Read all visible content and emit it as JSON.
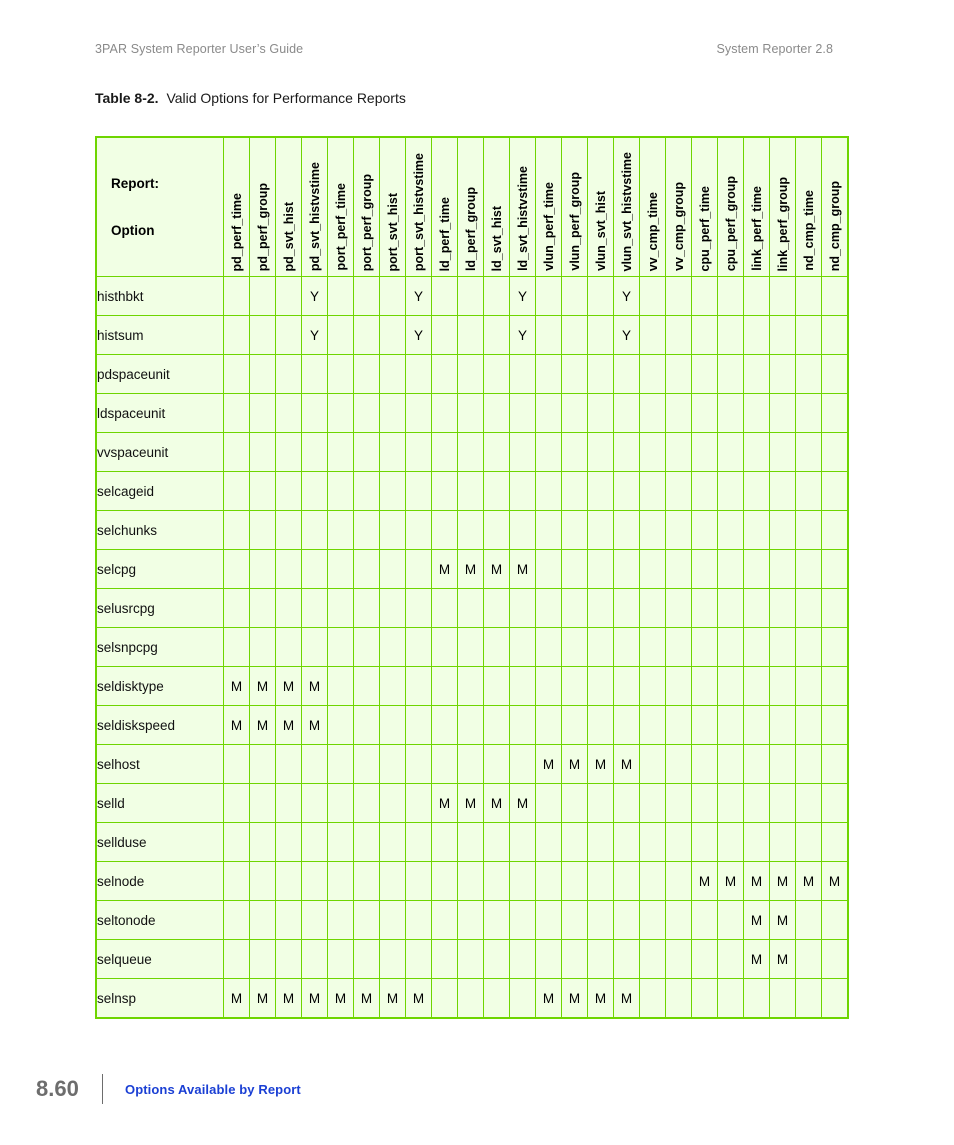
{
  "running_head": {
    "left": "3PAR System Reporter User’s Guide",
    "right": "System Reporter 2.8"
  },
  "caption": {
    "label": "Table 8-2.",
    "text": "Valid Options for Performance Reports"
  },
  "table": {
    "corner": {
      "report_label": "Report:",
      "option_label": "Option"
    },
    "columns": [
      "pd_perf_time",
      "pd_perf_group",
      "pd_svt_hist",
      "pd_svt_histvstime",
      "port_perf_time",
      "port_perf_group",
      "port_svt_hist",
      "port_svt_histvstime",
      "ld_perf_time",
      "ld_perf_group",
      "ld_svt_hist",
      "ld_svt_histvstime",
      "vlun_perf_time",
      "vlun_perf_group",
      "vlun_svt_hist",
      "vlun_svt_histvstime",
      "vv_cmp_time",
      "vv_cmp_group",
      "cpu_perf_time",
      "cpu_perf_group",
      "link_perf_time",
      "link_perf_group",
      "nd_cmp_time",
      "nd_cmp_group"
    ],
    "rows": [
      {
        "label": "histhbkt",
        "cells": [
          "",
          "",
          "",
          "Y",
          "",
          "",
          "",
          "Y",
          "",
          "",
          "",
          "Y",
          "",
          "",
          "",
          "Y",
          "",
          "",
          "",
          "",
          "",
          "",
          "",
          ""
        ]
      },
      {
        "label": "histsum",
        "cells": [
          "",
          "",
          "",
          "Y",
          "",
          "",
          "",
          "Y",
          "",
          "",
          "",
          "Y",
          "",
          "",
          "",
          "Y",
          "",
          "",
          "",
          "",
          "",
          "",
          "",
          ""
        ]
      },
      {
        "label": "pdspaceunit",
        "cells": [
          "",
          "",
          "",
          "",
          "",
          "",
          "",
          "",
          "",
          "",
          "",
          "",
          "",
          "",
          "",
          "",
          "",
          "",
          "",
          "",
          "",
          "",
          "",
          ""
        ]
      },
      {
        "label": "ldspaceunit",
        "cells": [
          "",
          "",
          "",
          "",
          "",
          "",
          "",
          "",
          "",
          "",
          "",
          "",
          "",
          "",
          "",
          "",
          "",
          "",
          "",
          "",
          "",
          "",
          "",
          ""
        ]
      },
      {
        "label": "vvspaceunit",
        "cells": [
          "",
          "",
          "",
          "",
          "",
          "",
          "",
          "",
          "",
          "",
          "",
          "",
          "",
          "",
          "",
          "",
          "",
          "",
          "",
          "",
          "",
          "",
          "",
          ""
        ]
      },
      {
        "label": "selcageid",
        "cells": [
          "",
          "",
          "",
          "",
          "",
          "",
          "",
          "",
          "",
          "",
          "",
          "",
          "",
          "",
          "",
          "",
          "",
          "",
          "",
          "",
          "",
          "",
          "",
          ""
        ]
      },
      {
        "label": "selchunks",
        "cells": [
          "",
          "",
          "",
          "",
          "",
          "",
          "",
          "",
          "",
          "",
          "",
          "",
          "",
          "",
          "",
          "",
          "",
          "",
          "",
          "",
          "",
          "",
          "",
          ""
        ]
      },
      {
        "label": "selcpg",
        "cells": [
          "",
          "",
          "",
          "",
          "",
          "",
          "",
          "",
          "M",
          "M",
          "M",
          "M",
          "",
          "",
          "",
          "",
          "",
          "",
          "",
          "",
          "",
          "",
          "",
          ""
        ]
      },
      {
        "label": "selusrcpg",
        "cells": [
          "",
          "",
          "",
          "",
          "",
          "",
          "",
          "",
          "",
          "",
          "",
          "",
          "",
          "",
          "",
          "",
          "",
          "",
          "",
          "",
          "",
          "",
          "",
          ""
        ]
      },
      {
        "label": "selsnpcpg",
        "cells": [
          "",
          "",
          "",
          "",
          "",
          "",
          "",
          "",
          "",
          "",
          "",
          "",
          "",
          "",
          "",
          "",
          "",
          "",
          "",
          "",
          "",
          "",
          "",
          ""
        ]
      },
      {
        "label": "seldisktype",
        "cells": [
          "M",
          "M",
          "M",
          "M",
          "",
          "",
          "",
          "",
          "",
          "",
          "",
          "",
          "",
          "",
          "",
          "",
          "",
          "",
          "",
          "",
          "",
          "",
          "",
          ""
        ]
      },
      {
        "label": "seldiskspeed",
        "cells": [
          "M",
          "M",
          "M",
          "M",
          "",
          "",
          "",
          "",
          "",
          "",
          "",
          "",
          "",
          "",
          "",
          "",
          "",
          "",
          "",
          "",
          "",
          "",
          "",
          ""
        ]
      },
      {
        "label": "selhost",
        "cells": [
          "",
          "",
          "",
          "",
          "",
          "",
          "",
          "",
          "",
          "",
          "",
          "",
          "M",
          "M",
          "M",
          "M",
          "",
          "",
          "",
          "",
          "",
          "",
          "",
          ""
        ]
      },
      {
        "label": "selld",
        "cells": [
          "",
          "",
          "",
          "",
          "",
          "",
          "",
          "",
          "M",
          "M",
          "M",
          "M",
          "",
          "",
          "",
          "",
          "",
          "",
          "",
          "",
          "",
          "",
          "",
          ""
        ]
      },
      {
        "label": "sellduse",
        "cells": [
          "",
          "",
          "",
          "",
          "",
          "",
          "",
          "",
          "",
          "",
          "",
          "",
          "",
          "",
          "",
          "",
          "",
          "",
          "",
          "",
          "",
          "",
          "",
          ""
        ]
      },
      {
        "label": "selnode",
        "cells": [
          "",
          "",
          "",
          "",
          "",
          "",
          "",
          "",
          "",
          "",
          "",
          "",
          "",
          "",
          "",
          "",
          "",
          "",
          "M",
          "M",
          "M",
          "M",
          "M",
          "M"
        ]
      },
      {
        "label": "seltonode",
        "cells": [
          "",
          "",
          "",
          "",
          "",
          "",
          "",
          "",
          "",
          "",
          "",
          "",
          "",
          "",
          "",
          "",
          "",
          "",
          "",
          "",
          "M",
          "M",
          "",
          ""
        ]
      },
      {
        "label": "selqueue",
        "cells": [
          "",
          "",
          "",
          "",
          "",
          "",
          "",
          "",
          "",
          "",
          "",
          "",
          "",
          "",
          "",
          "",
          "",
          "",
          "",
          "",
          "M",
          "M",
          "",
          ""
        ]
      },
      {
        "label": "selnsp",
        "cells": [
          "M",
          "M",
          "M",
          "M",
          "M",
          "M",
          "M",
          "M",
          "",
          "",
          "",
          "",
          "M",
          "M",
          "M",
          "M",
          "",
          "",
          "",
          "",
          "",
          "",
          "",
          ""
        ]
      }
    ]
  },
  "footer": {
    "folio": "8.60",
    "title": "Options Available by Report"
  },
  "colors": {
    "cell_fill": "#f1ffe4",
    "grid_line": "#6ed500",
    "footer_link": "#1a3fd4",
    "running_head": "#8a8a8a"
  }
}
